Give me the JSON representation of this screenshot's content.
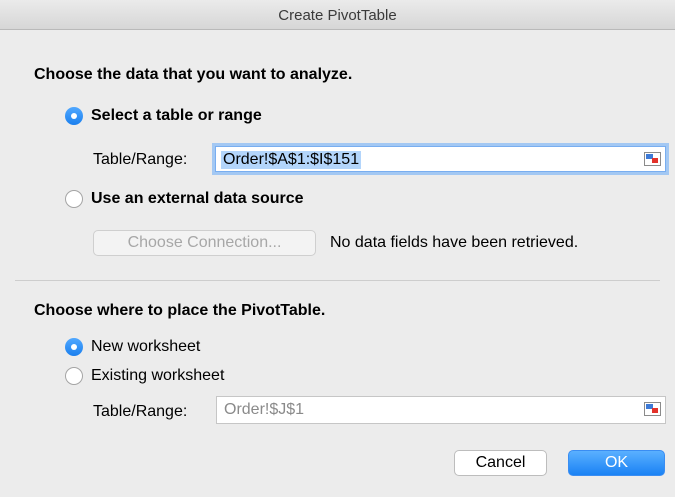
{
  "window": {
    "title": "Create PivotTable"
  },
  "data_section": {
    "heading": "Choose the data that you want to analyze.",
    "select_range_label": "Select a table or range",
    "select_range_checked": true,
    "table_range_label": "Table/Range:",
    "table_range_value": "Order!$A$1:$I$151",
    "external_source_label": "Use an external data source",
    "external_source_checked": false,
    "choose_connection_label": "Choose Connection...",
    "no_fields_text": "No data fields have been retrieved."
  },
  "placement_section": {
    "heading": "Choose where to place the PivotTable.",
    "new_worksheet_label": "New worksheet",
    "new_worksheet_checked": true,
    "existing_worksheet_label": "Existing worksheet",
    "existing_worksheet_checked": false,
    "table_range_label": "Table/Range:",
    "table_range_value": "Order!$J$1"
  },
  "buttons": {
    "cancel_label": "Cancel",
    "ok_label": "OK"
  },
  "icons": {
    "range_picker": "range-picker-icon",
    "radio_selected": "radio-selected",
    "radio_unselected": "radio-unselected"
  },
  "colors": {
    "accent": "#1a82f4",
    "selection_highlight": "#b3d5fb",
    "focus_ring": "#a3c8f3"
  }
}
